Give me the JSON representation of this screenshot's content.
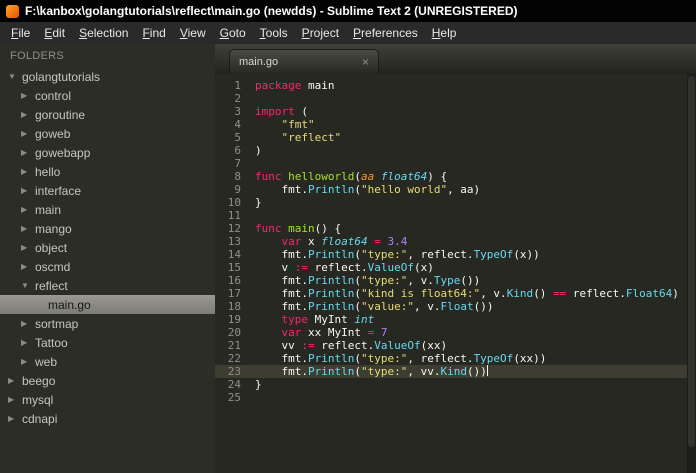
{
  "window": {
    "title": "F:\\kanbox\\golangtutorials\\reflect\\main.go (newdds) - Sublime Text 2 (UNREGISTERED)"
  },
  "menu": {
    "items": [
      "File",
      "Edit",
      "Selection",
      "Find",
      "View",
      "Goto",
      "Tools",
      "Project",
      "Preferences",
      "Help"
    ]
  },
  "sidebar": {
    "header": "FOLDERS",
    "items": [
      {
        "label": "golangtutorials",
        "level": 0,
        "type": "folder",
        "expanded": true
      },
      {
        "label": "control",
        "level": 1,
        "type": "folder",
        "expanded": false
      },
      {
        "label": "goroutine",
        "level": 1,
        "type": "folder",
        "expanded": false
      },
      {
        "label": "goweb",
        "level": 1,
        "type": "folder",
        "expanded": false
      },
      {
        "label": "gowebapp",
        "level": 1,
        "type": "folder",
        "expanded": false
      },
      {
        "label": "hello",
        "level": 1,
        "type": "folder",
        "expanded": false
      },
      {
        "label": "interface",
        "level": 1,
        "type": "folder",
        "expanded": false
      },
      {
        "label": "main",
        "level": 1,
        "type": "folder",
        "expanded": false
      },
      {
        "label": "mango",
        "level": 1,
        "type": "folder",
        "expanded": false
      },
      {
        "label": "object",
        "level": 1,
        "type": "folder",
        "expanded": false
      },
      {
        "label": "oscmd",
        "level": 1,
        "type": "folder",
        "expanded": false
      },
      {
        "label": "reflect",
        "level": 1,
        "type": "folder",
        "expanded": true
      },
      {
        "label": "main.go",
        "level": 2,
        "type": "file",
        "selected": true
      },
      {
        "label": "sortmap",
        "level": 1,
        "type": "folder",
        "expanded": false
      },
      {
        "label": "Tattoo",
        "level": 1,
        "type": "folder",
        "expanded": false
      },
      {
        "label": "web",
        "level": 1,
        "type": "folder",
        "expanded": false
      },
      {
        "label": "beego",
        "level": 0,
        "type": "folder",
        "expanded": false
      },
      {
        "label": "mysql",
        "level": 0,
        "type": "folder",
        "expanded": false
      },
      {
        "label": "cdnapi",
        "level": 0,
        "type": "folder",
        "expanded": false
      }
    ]
  },
  "tab": {
    "label": "main.go",
    "close": "×"
  },
  "editor": {
    "background": "#272822",
    "current_line": 23,
    "cursor_line": 23,
    "palette": {
      "k": {
        "color": "#f92672"
      },
      "f": {
        "color": "#a6e22e"
      },
      "t": {
        "color": "#66d9ef",
        "italic": true
      },
      "c": {
        "color": "#66d9ef"
      },
      "s": {
        "color": "#e6db74"
      },
      "n": {
        "color": "#ae81ff"
      },
      "o": {
        "color": "#f92672"
      },
      "p": {
        "color": "#f8f8f2"
      },
      "a": {
        "color": "#fd971f",
        "italic": true
      }
    },
    "lines": [
      [
        [
          "k",
          "package"
        ],
        [
          "p",
          " main"
        ]
      ],
      [],
      [
        [
          "k",
          "import"
        ],
        [
          "p",
          " ("
        ]
      ],
      [
        [
          "p",
          "    "
        ],
        [
          "s",
          "\"fmt\""
        ]
      ],
      [
        [
          "p",
          "    "
        ],
        [
          "s",
          "\"reflect\""
        ]
      ],
      [
        [
          "p",
          ")"
        ]
      ],
      [],
      [
        [
          "k",
          "func"
        ],
        [
          "p",
          " "
        ],
        [
          "f",
          "helloworld"
        ],
        [
          "p",
          "("
        ],
        [
          "a",
          "aa"
        ],
        [
          "p",
          " "
        ],
        [
          "t",
          "float64"
        ],
        [
          "p",
          ") {"
        ]
      ],
      [
        [
          "p",
          "    fmt."
        ],
        [
          "c",
          "Println"
        ],
        [
          "p",
          "("
        ],
        [
          "s",
          "\"hello world\""
        ],
        [
          "p",
          ", aa)"
        ]
      ],
      [
        [
          "p",
          "}"
        ]
      ],
      [],
      [
        [
          "k",
          "func"
        ],
        [
          "p",
          " "
        ],
        [
          "f",
          "main"
        ],
        [
          "p",
          "() {"
        ]
      ],
      [
        [
          "p",
          "    "
        ],
        [
          "k",
          "var"
        ],
        [
          "p",
          " x "
        ],
        [
          "t",
          "float64"
        ],
        [
          "p",
          " "
        ],
        [
          "o",
          "="
        ],
        [
          "p",
          " "
        ],
        [
          "n",
          "3.4"
        ]
      ],
      [
        [
          "p",
          "    fmt."
        ],
        [
          "c",
          "Println"
        ],
        [
          "p",
          "("
        ],
        [
          "s",
          "\"type:\""
        ],
        [
          "p",
          ", reflect."
        ],
        [
          "c",
          "TypeOf"
        ],
        [
          "p",
          "(x))"
        ]
      ],
      [
        [
          "p",
          "    v "
        ],
        [
          "o",
          ":="
        ],
        [
          "p",
          " reflect."
        ],
        [
          "c",
          "ValueOf"
        ],
        [
          "p",
          "(x)"
        ]
      ],
      [
        [
          "p",
          "    fmt."
        ],
        [
          "c",
          "Println"
        ],
        [
          "p",
          "("
        ],
        [
          "s",
          "\"type:\""
        ],
        [
          "p",
          ", v."
        ],
        [
          "c",
          "Type"
        ],
        [
          "p",
          "())"
        ]
      ],
      [
        [
          "p",
          "    fmt."
        ],
        [
          "c",
          "Println"
        ],
        [
          "p",
          "("
        ],
        [
          "s",
          "\"kind is float64:\""
        ],
        [
          "p",
          ", v."
        ],
        [
          "c",
          "Kind"
        ],
        [
          "p",
          "() "
        ],
        [
          "o",
          "=="
        ],
        [
          "p",
          " reflect."
        ],
        [
          "c",
          "Float64"
        ],
        [
          "p",
          ")"
        ]
      ],
      [
        [
          "p",
          "    fmt."
        ],
        [
          "c",
          "Println"
        ],
        [
          "p",
          "("
        ],
        [
          "s",
          "\"value:\""
        ],
        [
          "p",
          ", v."
        ],
        [
          "c",
          "Float"
        ],
        [
          "p",
          "())"
        ]
      ],
      [
        [
          "p",
          "    "
        ],
        [
          "k",
          "type"
        ],
        [
          "p",
          " MyInt "
        ],
        [
          "t",
          "int"
        ]
      ],
      [
        [
          "p",
          "    "
        ],
        [
          "k",
          "var"
        ],
        [
          "p",
          " xx MyInt "
        ],
        [
          "o",
          "="
        ],
        [
          "p",
          " "
        ],
        [
          "n",
          "7"
        ]
      ],
      [
        [
          "p",
          "    vv "
        ],
        [
          "o",
          ":="
        ],
        [
          "p",
          " reflect."
        ],
        [
          "c",
          "ValueOf"
        ],
        [
          "p",
          "(xx)"
        ]
      ],
      [
        [
          "p",
          "    fmt."
        ],
        [
          "c",
          "Println"
        ],
        [
          "p",
          "("
        ],
        [
          "s",
          "\"type:\""
        ],
        [
          "p",
          ", reflect."
        ],
        [
          "c",
          "TypeOf"
        ],
        [
          "p",
          "(xx))"
        ]
      ],
      [
        [
          "p",
          "    fmt."
        ],
        [
          "c",
          "Println"
        ],
        [
          "p",
          "("
        ],
        [
          "s",
          "\"type:\""
        ],
        [
          "p",
          ", vv."
        ],
        [
          "c",
          "Kind"
        ],
        [
          "p",
          "())"
        ]
      ],
      [
        [
          "p",
          "}"
        ]
      ],
      []
    ]
  }
}
